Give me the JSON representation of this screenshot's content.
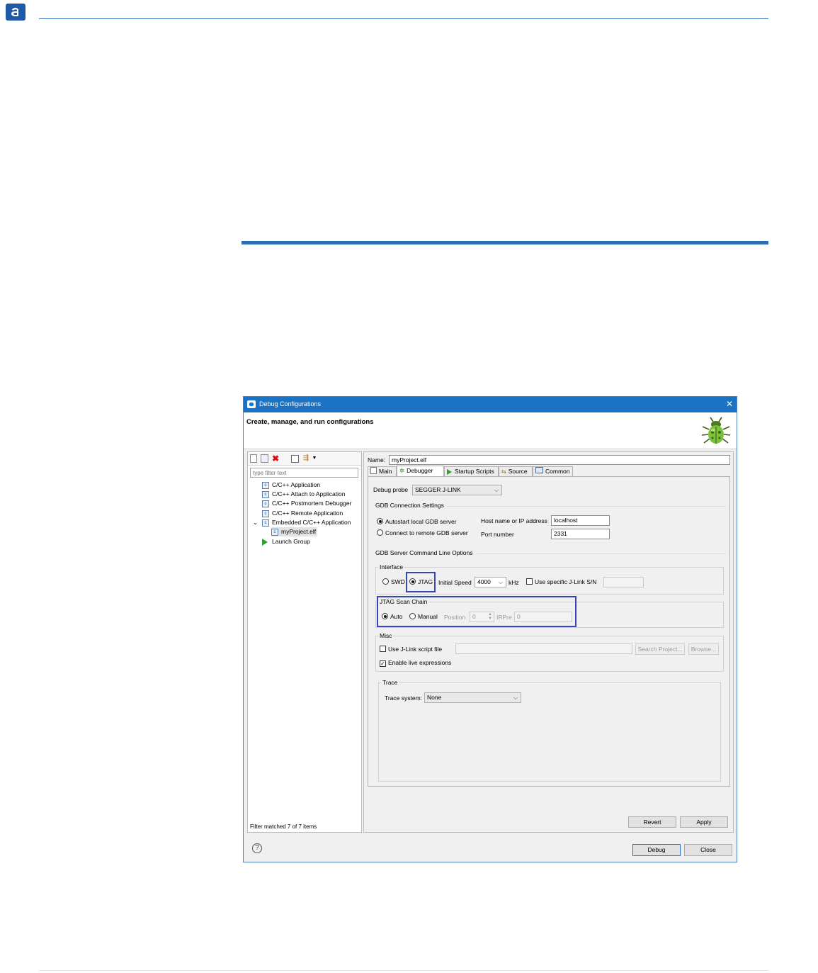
{
  "dialog": {
    "title": "Debug Configurations",
    "close": "✕",
    "banner": "Create, manage, and run configurations"
  },
  "left": {
    "filter_placeholder": "type filter text",
    "tree": [
      {
        "label": "C/C++ Application"
      },
      {
        "label": "C/C++ Attach to Application"
      },
      {
        "label": "C/C++ Postmortem Debugger"
      },
      {
        "label": "C/C++ Remote Application"
      },
      {
        "label": "Embedded C/C++ Application"
      },
      {
        "label": "myProject.elf"
      },
      {
        "label": "Launch Group"
      }
    ],
    "status": "Filter matched 7 of 7 items"
  },
  "right": {
    "name_label": "Name:",
    "name_value": "myProject.elf",
    "tabs": [
      "Main",
      "Debugger",
      "Startup Scripts",
      "Source",
      "Common"
    ],
    "active_tab": "Debugger",
    "debug_probe_label": "Debug probe",
    "debug_probe_value": "SEGGER J-LINK",
    "gdb_conn": {
      "title": "GDB Connection Settings",
      "autostart": "Autostart local GDB server",
      "remote": "Connect to remote GDB server",
      "host_label": "Host name or IP address",
      "host_value": "localhost",
      "port_label": "Port number",
      "port_value": "2331"
    },
    "gdb_cmd_title": "GDB Server Command Line Options",
    "interface": {
      "title": "Interface",
      "swd": "SWD",
      "jtag": "JTAG",
      "speed_label": "Initial Speed",
      "speed_value": "4000",
      "khz": "kHz",
      "use_sn": "Use specific J-Link S/N"
    },
    "scan_chain": {
      "title": "JTAG Scan Chain",
      "auto": "Auto",
      "manual": "Manual",
      "position_label": "Position",
      "position_value": "0",
      "irpre_label": "IRPre",
      "irpre_value": "0"
    },
    "misc": {
      "title": "Misc",
      "use_script": "Use J-Link script file",
      "search_project": "Search Project...",
      "browse": "Browse...",
      "live_expr": "Enable live expressions"
    },
    "trace": {
      "title": "Trace",
      "system_label": "Trace system:",
      "system_value": "None"
    },
    "revert": "Revert",
    "apply": "Apply"
  },
  "footer": {
    "help": "?",
    "debug": "Debug",
    "close": "Close"
  },
  "colors": {
    "accent": "#2d6db5",
    "titlebar": "#1b73c5",
    "highlight": "#3447b8"
  }
}
